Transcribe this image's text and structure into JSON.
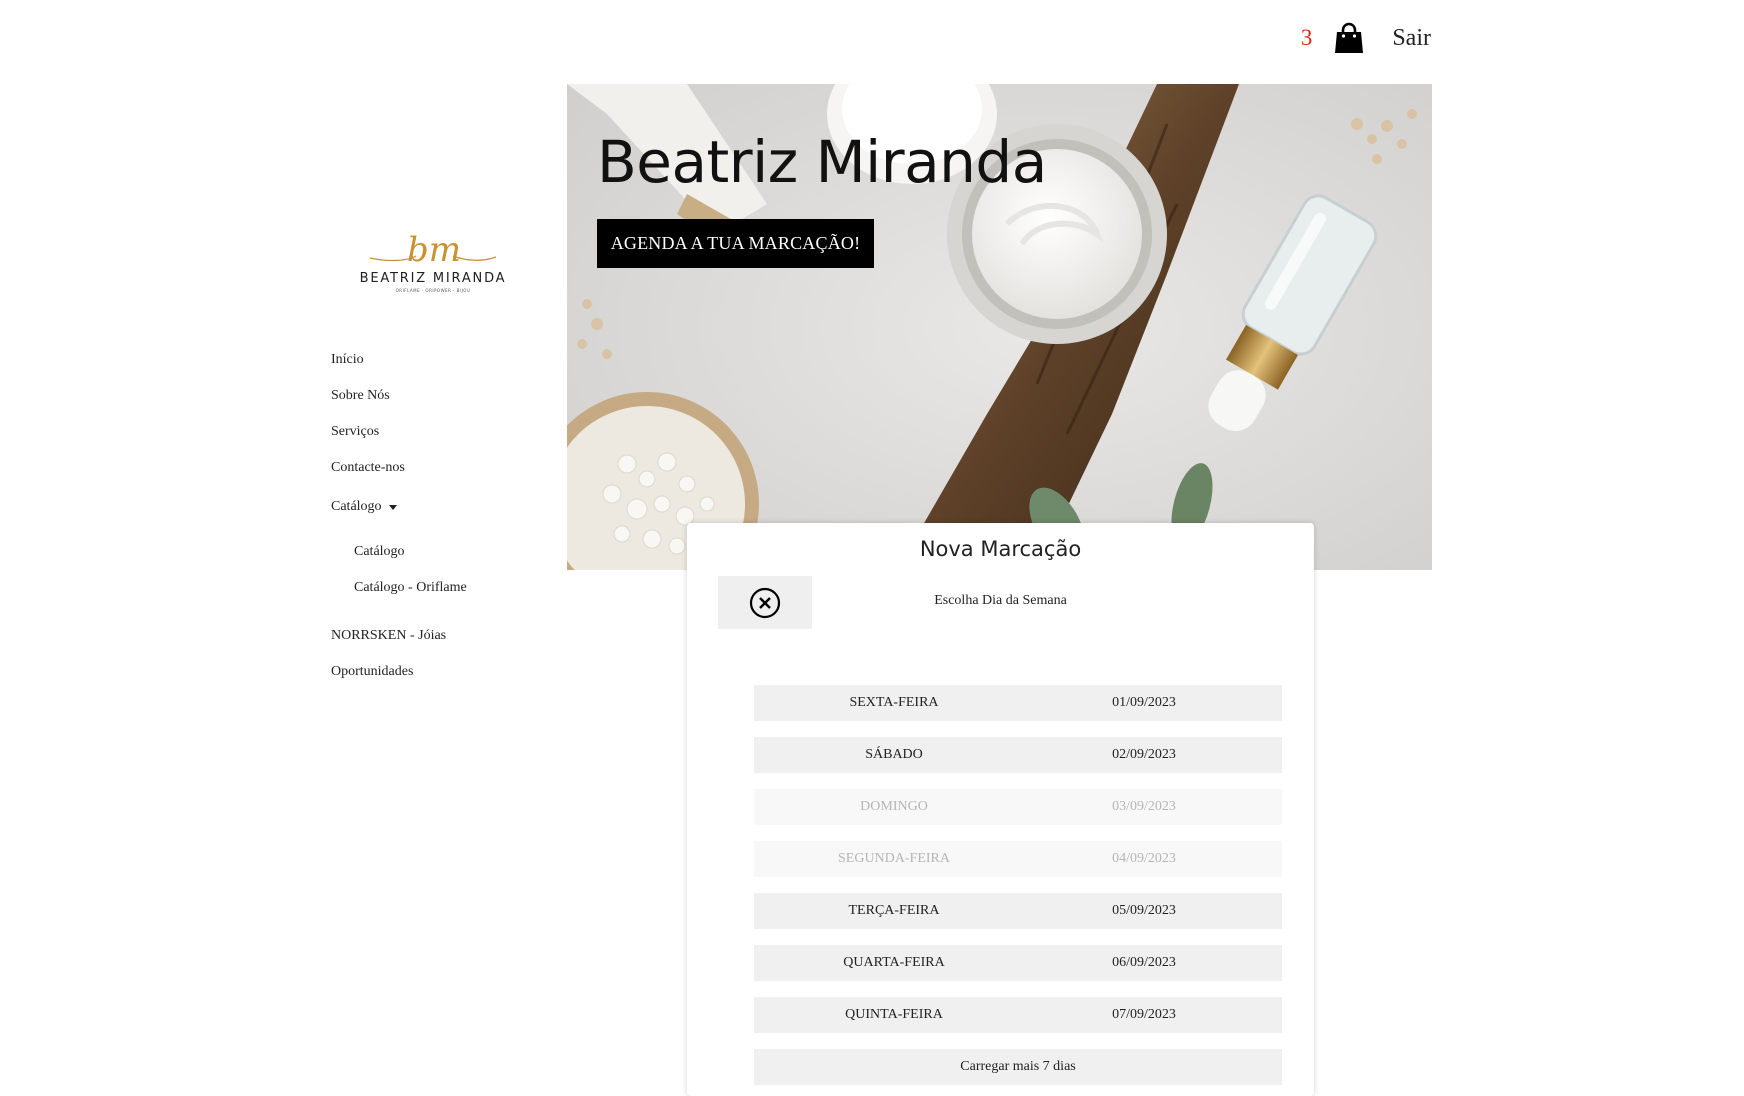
{
  "topbar": {
    "cart_count": "3",
    "logout_label": "Sair"
  },
  "brand": {
    "logo_monogram": "bm",
    "logo_name": "BEATRIZ MIRANDA",
    "logo_tagline": "ORIFLAME · ORIPOWER · BIJOU"
  },
  "sidebar": {
    "items": [
      {
        "label": "Início"
      },
      {
        "label": "Sobre Nós"
      },
      {
        "label": "Serviços"
      },
      {
        "label": "Contacte-nos"
      },
      {
        "label": "Catálogo"
      }
    ],
    "submenu": [
      {
        "label": "Catálogo"
      },
      {
        "label": "Catálogo - Oriflame"
      }
    ],
    "items_after": [
      {
        "label": "NORRSKEN - Jóias"
      },
      {
        "label": "Oportunidades"
      }
    ]
  },
  "hero": {
    "title": "Beatriz Miranda",
    "cta_label": "AGENDA A TUA MARCAÇÃO!"
  },
  "modal": {
    "title": "Nova Marcação",
    "subtitle": "Escolha Dia da Semana",
    "days": [
      {
        "name": "SEXTA-FEIRA",
        "date": "01/09/2023",
        "available": true
      },
      {
        "name": "SÁBADO",
        "date": "02/09/2023",
        "available": true
      },
      {
        "name": "DOMINGO",
        "date": "03/09/2023",
        "available": false
      },
      {
        "name": "SEGUNDA-FEIRA",
        "date": "04/09/2023",
        "available": false
      },
      {
        "name": "TERÇA-FEIRA",
        "date": "05/09/2023",
        "available": true
      },
      {
        "name": "QUARTA-FEIRA",
        "date": "06/09/2023",
        "available": true
      },
      {
        "name": "QUINTA-FEIRA",
        "date": "07/09/2023",
        "available": true
      }
    ],
    "load_more_label": "Carregar mais 7 dias"
  },
  "colors": {
    "accent_red": "#e0241b",
    "logo_gold": "#c8922e",
    "button_black": "#000000",
    "row_gray": "#f0f0f0"
  },
  "icons": [
    "shopping-bag-icon",
    "caret-down-icon",
    "close-circle-icon"
  ]
}
